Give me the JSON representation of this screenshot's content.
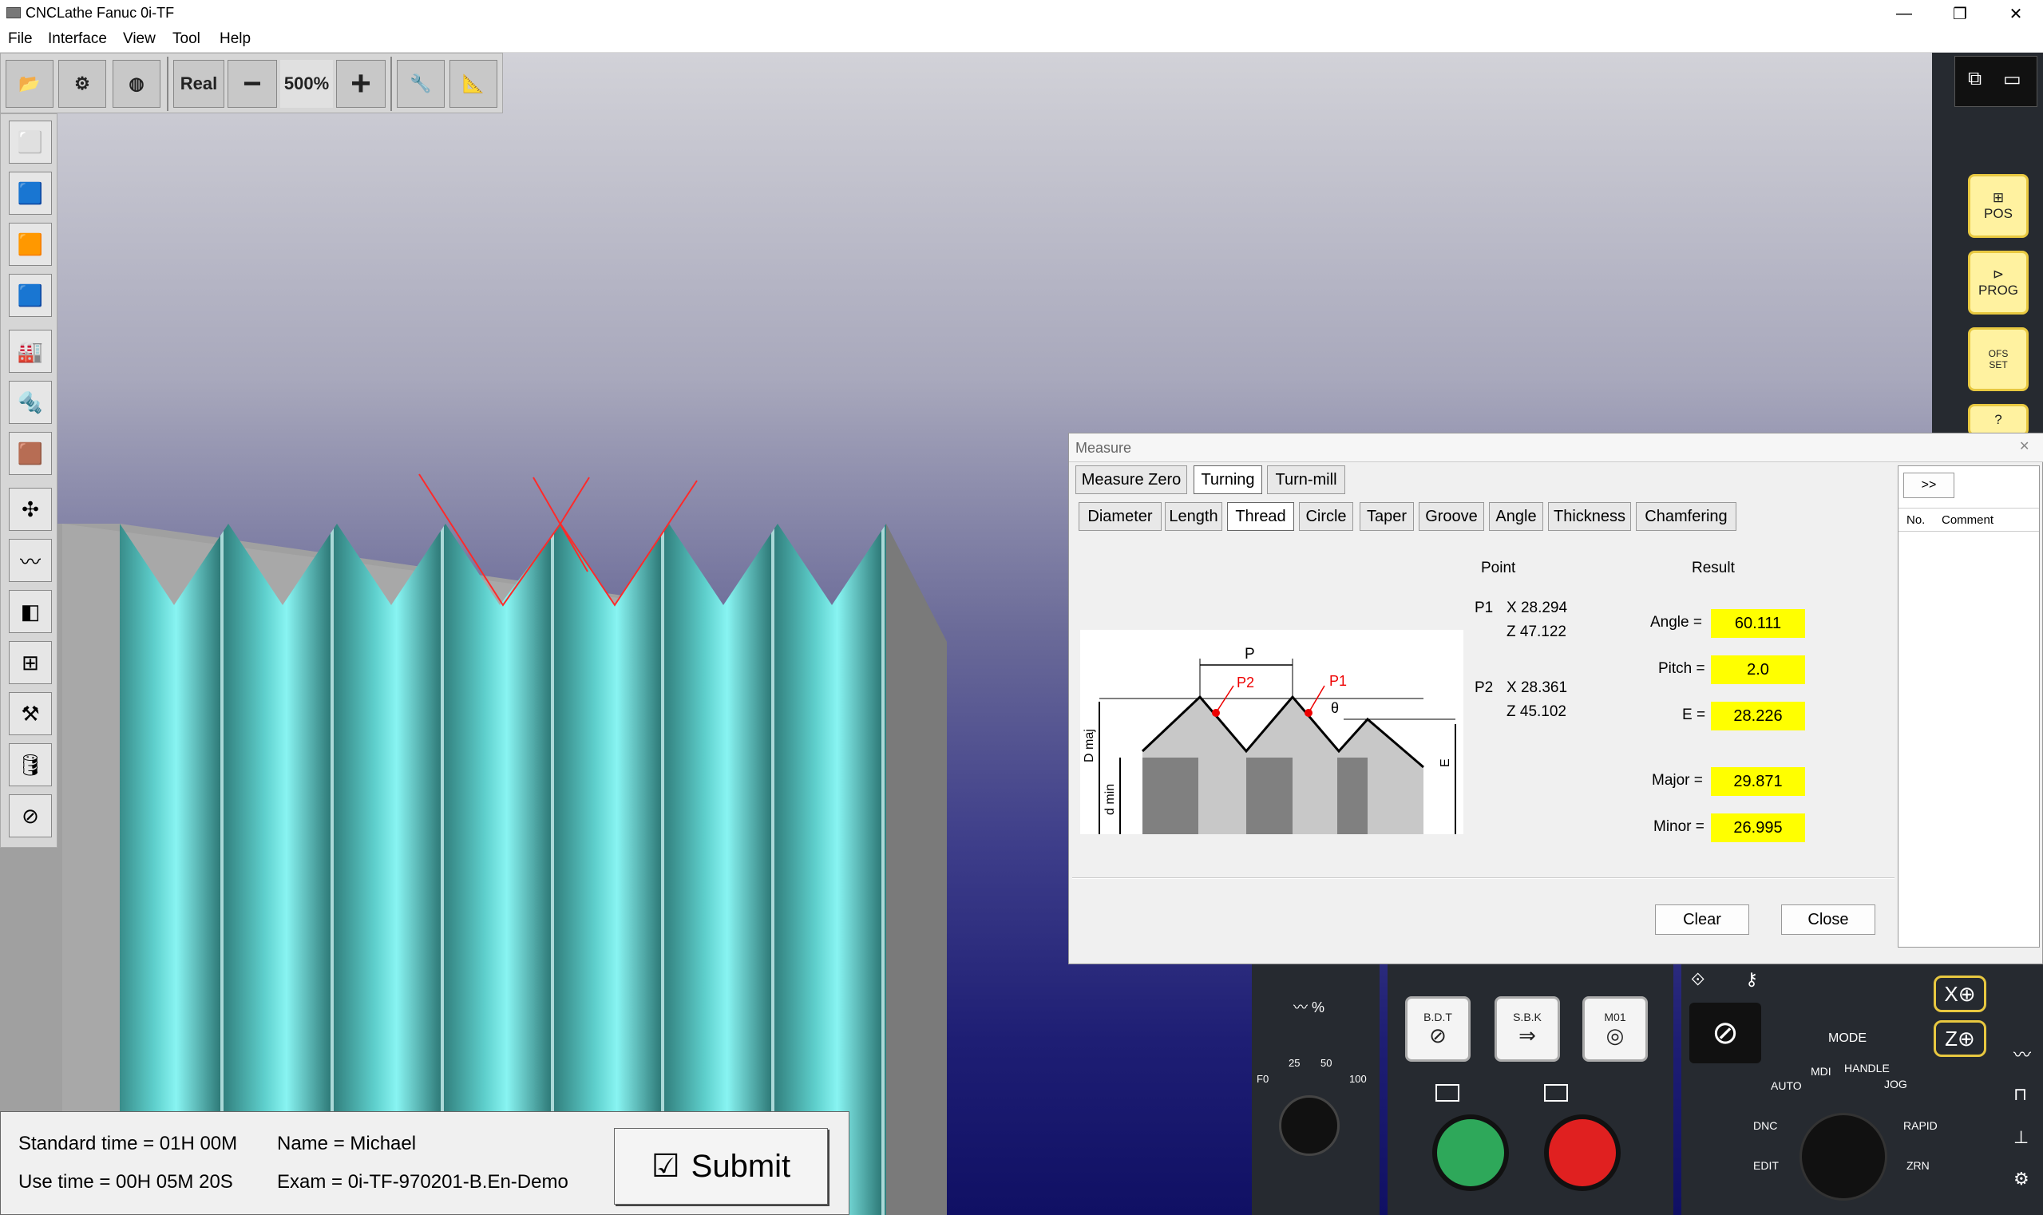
{
  "window": {
    "title": "CNCLathe Fanuc 0i-TF"
  },
  "menu": [
    "File",
    "Interface",
    "View",
    "Tool",
    "Help"
  ],
  "toolbar": {
    "real_label": "Real",
    "minus_label": "−",
    "zoom": "500%",
    "plus_label": "+"
  },
  "measure": {
    "title": "Measure",
    "mode_tabs": [
      "Measure Zero",
      "Turning",
      "Turn-mill"
    ],
    "active_mode": "Turning",
    "type_tabs": [
      "Diameter",
      "Length",
      "Thread",
      "Circle",
      "Taper",
      "Groove",
      "Angle",
      "Thickness",
      "Chamfering"
    ],
    "active_type": "Thread",
    "point_header": "Point",
    "result_header": "Result",
    "p1": {
      "label": "P1",
      "x": "X 28.294",
      "z": "Z 47.122"
    },
    "p2": {
      "label": "P2",
      "x": "X 28.361",
      "z": "Z 45.102"
    },
    "results": [
      {
        "label": "Angle =",
        "value": "60.111"
      },
      {
        "label": "Pitch =",
        "value": "2.0"
      },
      {
        "label": "E =",
        "value": "28.226"
      },
      {
        "label": "Major =",
        "value": "29.871"
      },
      {
        "label": "Minor =",
        "value": "26.995"
      }
    ],
    "diagram": {
      "p": "P",
      "p1": "P1",
      "p2": "P2",
      "theta": "θ",
      "dmaj": "D maj",
      "dmin": "d min",
      "e": "E"
    },
    "clear_label": "Clear",
    "close_label": "Close",
    "expand_label": ">>",
    "list_headers": [
      "No.",
      "Comment"
    ]
  },
  "right_panel": {
    "pos": "POS",
    "prog": "PROG",
    "ofs": "OFS",
    "set": "SET",
    "help": "?"
  },
  "control": {
    "feed_label": "% ",
    "dial_labels": [
      "F0",
      "25",
      "50",
      "100"
    ],
    "bdt": "B.D.T",
    "sbk": "S.B.K",
    "m01": "M01",
    "mode": "MODE",
    "modes": [
      "AUTO",
      "MDI",
      "HANDLE",
      "JOG",
      "DNC",
      "EDIT",
      "RAPID",
      "ZRN"
    ],
    "x_axis": "X",
    "z_axis": "Z"
  },
  "status": {
    "standard_time": "Standard time = 01H 00M",
    "use_time": "Use time = 00H 05M 20S",
    "name": "Name = Michael",
    "exam": "Exam = 0i-TF-970201-B.En-Demo",
    "submit_label": "Submit"
  },
  "colors": {
    "part": "#5ecfcc",
    "value_bg": "#ffff00",
    "panel": "#262a30"
  }
}
